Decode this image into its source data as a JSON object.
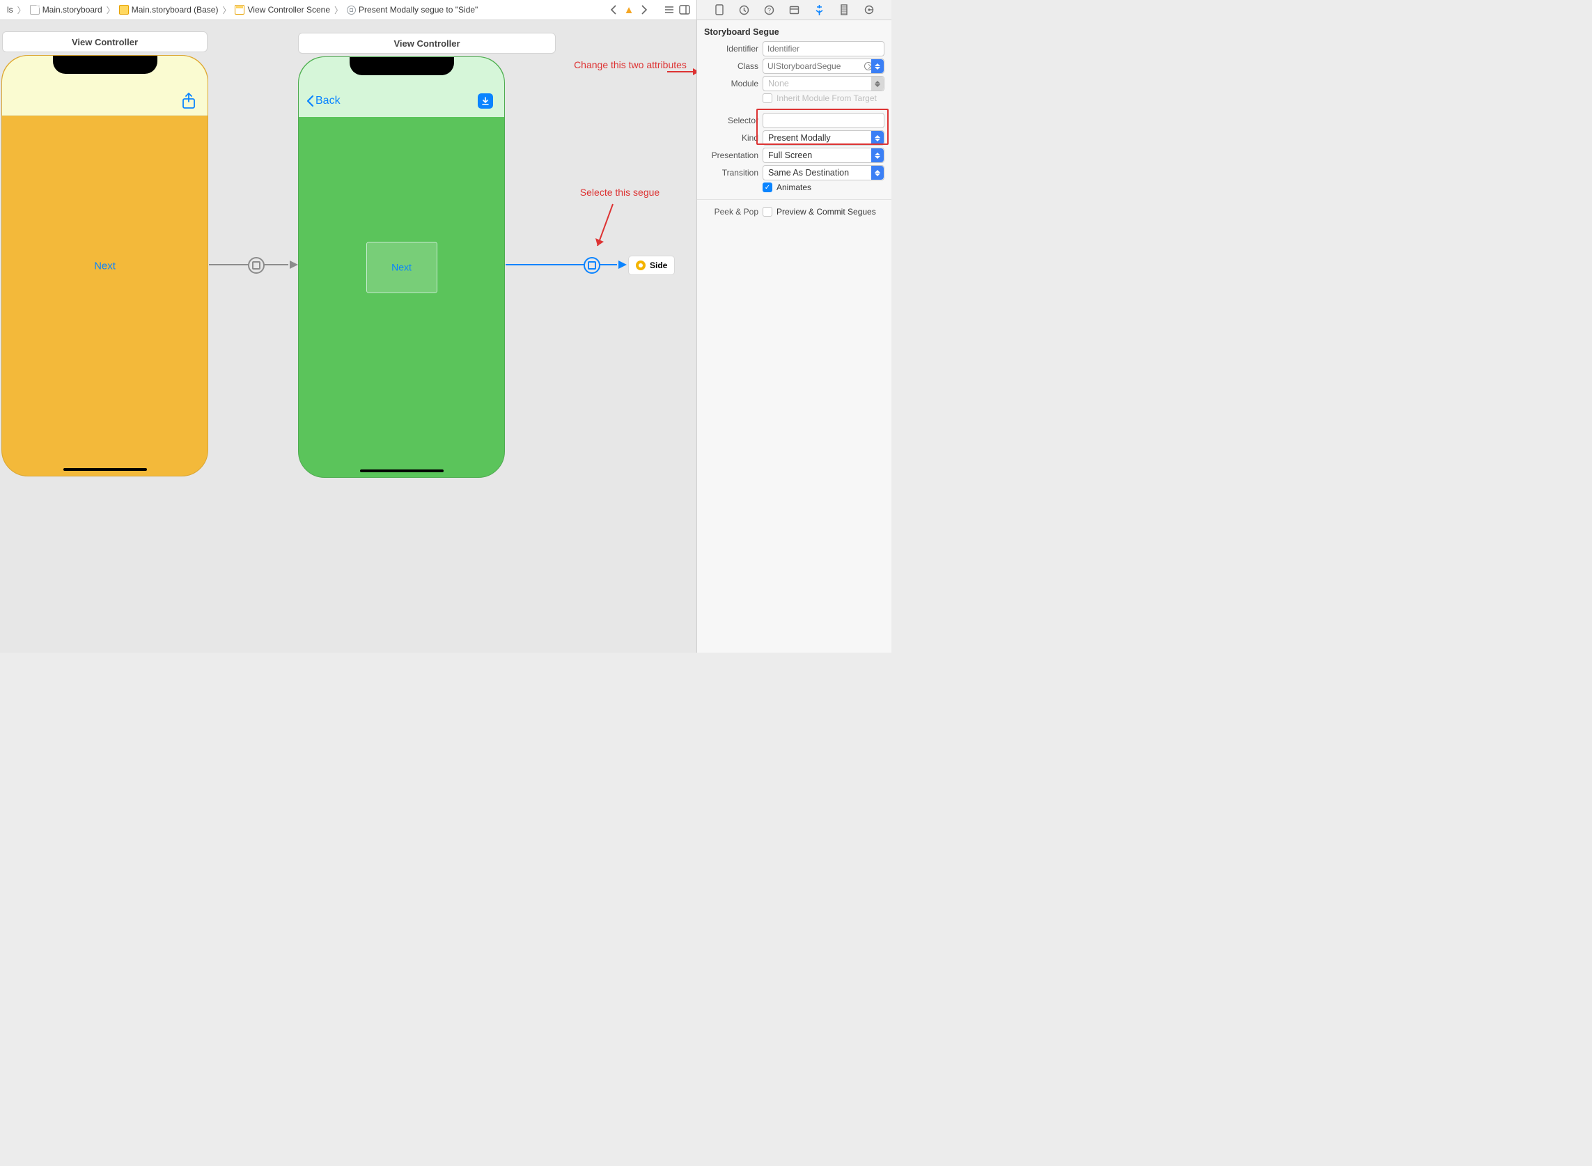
{
  "pathbar": {
    "seg0": "ls",
    "seg1": "Main.storyboard",
    "seg2": "Main.storyboard (Base)",
    "seg3": "View Controller Scene",
    "seg4": "Present Modally segue to \"Side\""
  },
  "scenes": {
    "vc1_title": "View Controller",
    "vc2_title": "View Controller",
    "vc1_next": "Next",
    "vc2_back": "Back",
    "vc2_next": "Next",
    "side_ref": "Side"
  },
  "annotations": {
    "change_attrs": "Change this two attributes",
    "select_segue": "Selecte this segue"
  },
  "inspector": {
    "section": "Storyboard Segue",
    "identifier_label": "Identifier",
    "identifier_placeholder": "Identifier",
    "class_label": "Class",
    "class_value": "UIStoryboardSegue",
    "module_label": "Module",
    "module_value": "None",
    "inherit_label": "Inherit Module From Target",
    "selector_label": "Selector",
    "kind_label": "Kind",
    "kind_value": "Present Modally",
    "presentation_label": "Presentation",
    "presentation_value": "Full Screen",
    "transition_label": "Transition",
    "transition_value": "Same As Destination",
    "animates_label": "Animates",
    "peekpop_label": "Peek & Pop",
    "peekpop_value": "Preview & Commit Segues"
  }
}
